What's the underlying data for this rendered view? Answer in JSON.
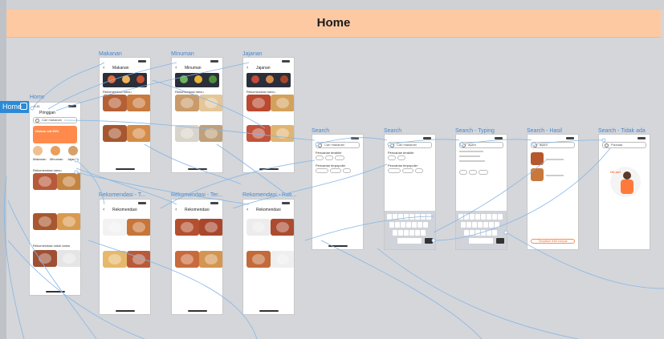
{
  "header": {
    "title": "Home"
  },
  "home_tag": {
    "label": "Home"
  },
  "frames": {
    "home": {
      "label": "Home",
      "status_time": "9:41",
      "location": "Pringgan",
      "search_placeholder": "Cari makanan",
      "promo_text": "Diskon s/d 60%",
      "categories": [
        "Makanan",
        "Minuman",
        "Jajanan"
      ],
      "section1": "Rekomendasi menu",
      "section2": "Rekomendasi untuk kamu"
    },
    "makanan": {
      "label": "Makanan",
      "title": "Makanan",
      "section": "Rekomendasi menu"
    },
    "minuman": {
      "label": "Minuman",
      "title": "Minuman",
      "section": "Rekomendasi menu"
    },
    "jajanan": {
      "label": "Jajanan",
      "title": "Jajanan",
      "section": "Rekomendasi menu"
    },
    "rek1": {
      "label": "Rekomendasi - T...",
      "title": "Rekomendasi"
    },
    "rek2": {
      "label": "Rekomendasi - Ter...",
      "title": "Rekomendasi"
    },
    "rek3": {
      "label": "Rekomendasi - Rati...",
      "title": "Rekomendasi"
    },
    "search1": {
      "label": "Search",
      "placeholder": "Cari makanan",
      "recent": "Pencarian terakhir",
      "popular": "Pencarian terpopuler"
    },
    "search2": {
      "label": "Search",
      "placeholder": "Cari makanan",
      "recent": "Pencarian terakhir",
      "popular": "Pencarian terpopuler"
    },
    "search3": {
      "label": "Search - Typing",
      "query": "ayam"
    },
    "search4": {
      "label": "Search - Hasil",
      "query": "ayam",
      "button": "Tampilkan lebih banyak"
    },
    "search5": {
      "label": "Search - Tidak ada",
      "query": "Pizzaaa",
      "empty_text": "Oh no!"
    }
  },
  "colors": {
    "header": "#fdc9a3",
    "accent": "#ff6a2c",
    "link": "#7fb2e5",
    "tag": "#2b8ad6"
  }
}
